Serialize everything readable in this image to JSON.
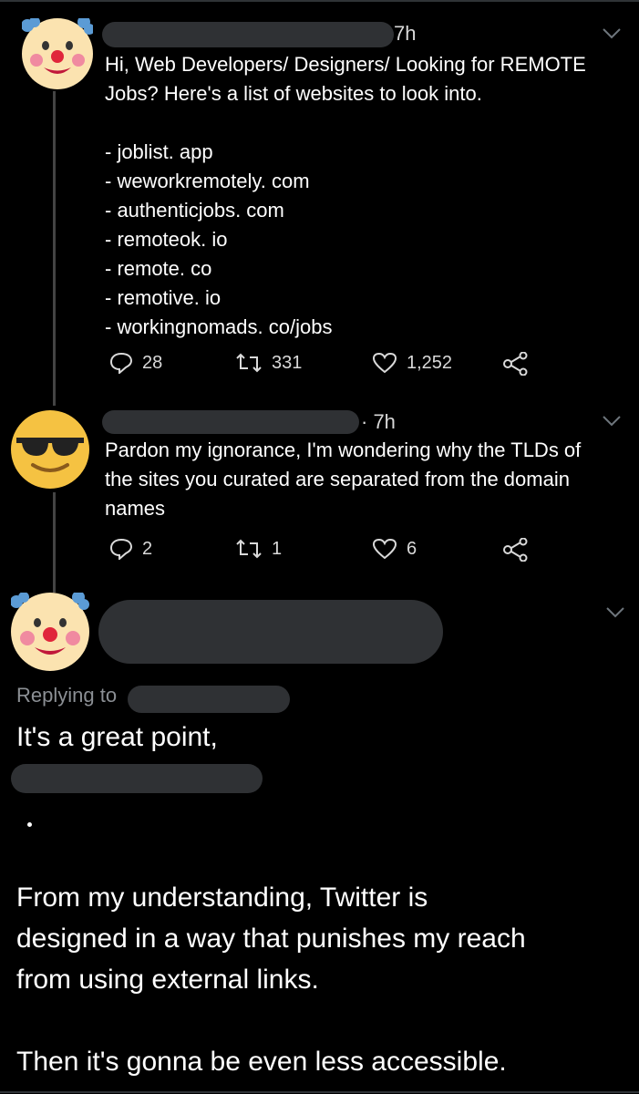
{
  "tweet1": {
    "time": "7h",
    "text": "Hi, Web Developers/ Designers/ Looking for REMOTE\nJobs? Here's a list of websites to look into.\n\n- joblist. app\n- weworkremotely. com\n- authenticjobs. com\n- remoteok. io\n- remote. co\n- remotive. io\n- workingnomads. co/jobs",
    "replies": "28",
    "retweets": "331",
    "likes": "1,252",
    "avatar_icon": "clown-face-icon"
  },
  "tweet2": {
    "time": "· 7h",
    "text": "Pardon my ignorance, I'm wondering why the TLDs of\nthe sites you curated are separated from the domain\nnames",
    "replies": "2",
    "retweets": "1",
    "likes": "6",
    "avatar_icon": "sunglasses-face-icon"
  },
  "tweet3": {
    "replying_to_label": "Replying to",
    "text_line1": "It's a great point,",
    "text_body": "From my understanding, Twitter is\ndesigned in a way that punishes my reach\nfrom using external links.\n\nThen it's gonna be even less accessible.",
    "avatar_icon": "clown-face-icon"
  },
  "colors": {
    "background": "#000000",
    "text": "#ffffff",
    "secondary": "#8b8f94",
    "redaction": "#2f3134"
  }
}
